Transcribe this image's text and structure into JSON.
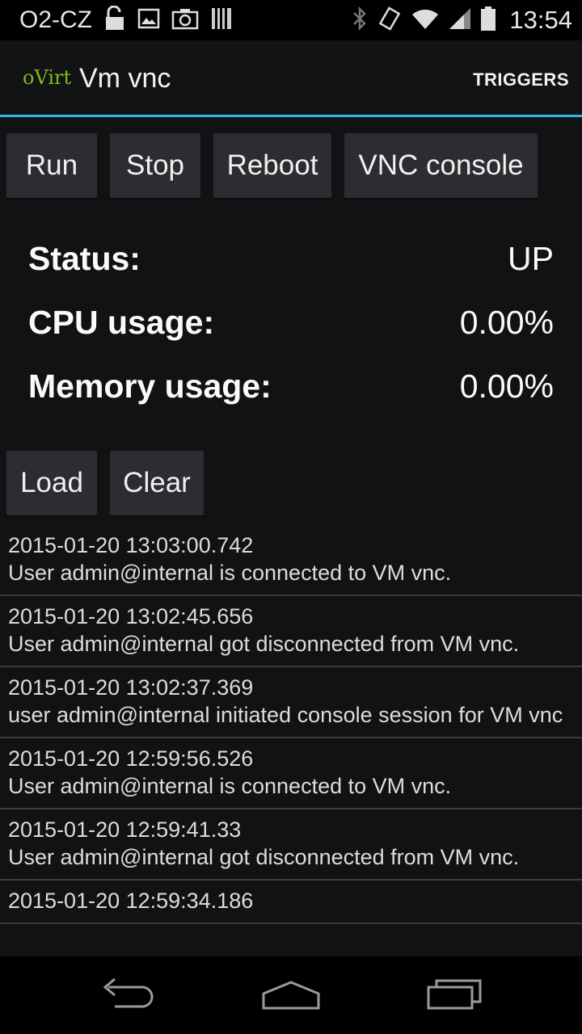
{
  "status_bar": {
    "carrier": "O2-CZ",
    "time": "13:54",
    "icons": [
      "lock-open-icon",
      "image-icon",
      "camera-icon",
      "sd-card-icon",
      "bluetooth-icon",
      "vibrate-icon",
      "wifi-icon",
      "cell-signal-icon",
      "battery-icon"
    ]
  },
  "action_bar": {
    "logo": "oVirt",
    "title": "Vm vnc",
    "action": "TRIGGERS",
    "accent_color": "#33b5e5"
  },
  "controls": {
    "run": "Run",
    "stop": "Stop",
    "reboot": "Reboot",
    "vnc": "VNC console"
  },
  "stats": {
    "status_label": "Status:",
    "status_value": "UP",
    "cpu_label": "CPU usage:",
    "cpu_value": "0.00%",
    "mem_label": "Memory usage:",
    "mem_value": "0.00%"
  },
  "event_controls": {
    "load": "Load",
    "clear": "Clear"
  },
  "events": [
    {
      "time": "2015-01-20 13:03:00.742",
      "message": "User admin@internal is connected to VM vnc."
    },
    {
      "time": "2015-01-20 13:02:45.656",
      "message": "User admin@internal got disconnected from VM vnc."
    },
    {
      "time": "2015-01-20 13:02:37.369",
      "message": "user admin@internal initiated console session for VM vnc"
    },
    {
      "time": "2015-01-20 12:59:56.526",
      "message": "User admin@internal is connected to VM vnc."
    },
    {
      "time": "2015-01-20 12:59:41.33",
      "message": "User admin@internal got disconnected from VM vnc."
    },
    {
      "time": "2015-01-20 12:59:34.186",
      "message": ""
    }
  ],
  "nav": {
    "icons": [
      "back-icon",
      "home-icon",
      "recent-apps-icon"
    ]
  }
}
